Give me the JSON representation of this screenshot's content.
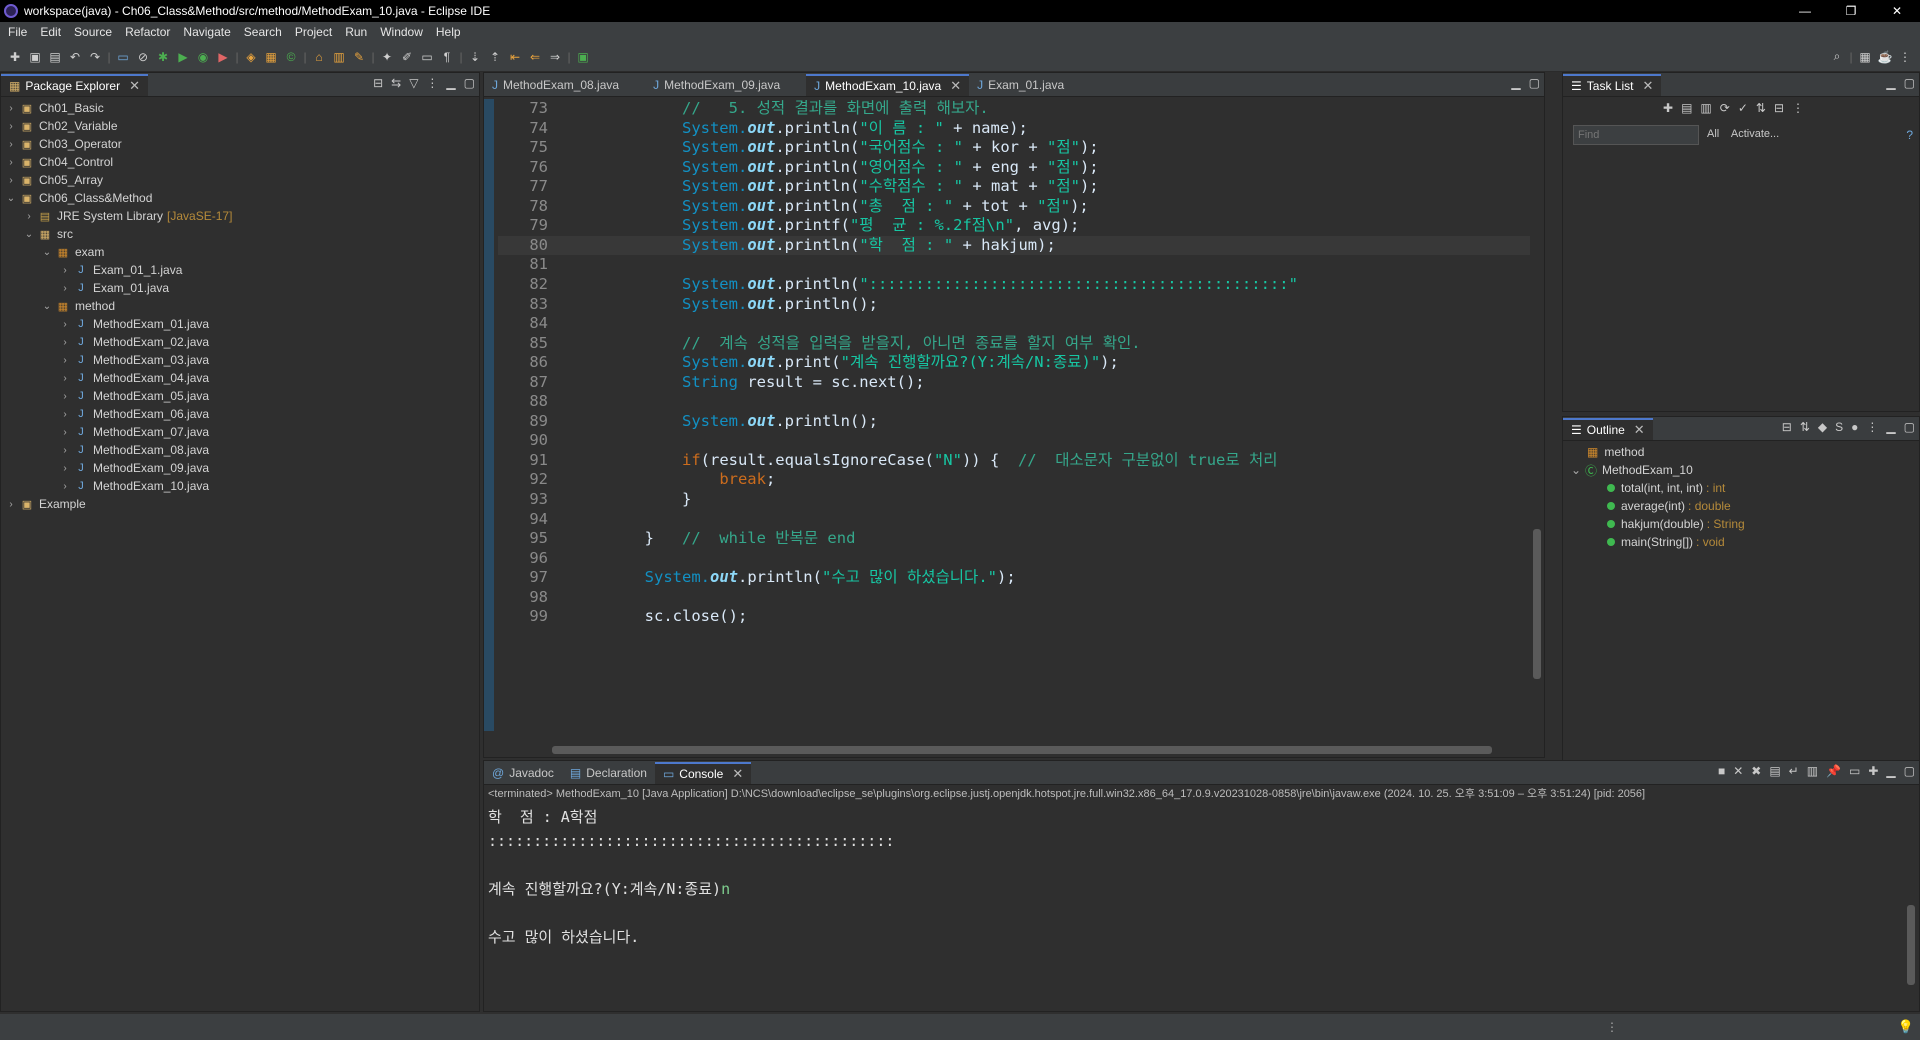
{
  "window": {
    "title": "workspace(java) - Ch06_Class&Method/src/method/MethodExam_10.java - Eclipse IDE",
    "controls": [
      "—",
      "❐",
      "✕"
    ]
  },
  "menu": [
    "File",
    "Edit",
    "Source",
    "Refactor",
    "Navigate",
    "Search",
    "Project",
    "Run",
    "Window",
    "Help"
  ],
  "package_explorer": {
    "title": "Package Explorer",
    "tree": [
      {
        "label": "Ch01_Basic",
        "type": "project",
        "depth": 0,
        "arrow": "›"
      },
      {
        "label": "Ch02_Variable",
        "type": "project",
        "depth": 0,
        "arrow": "›"
      },
      {
        "label": "Ch03_Operator",
        "type": "project",
        "depth": 0,
        "arrow": "›"
      },
      {
        "label": "Ch04_Control",
        "type": "project",
        "depth": 0,
        "arrow": "›"
      },
      {
        "label": "Ch05_Array",
        "type": "project",
        "depth": 0,
        "arrow": "›"
      },
      {
        "label": "Ch06_Class&Method",
        "type": "project",
        "depth": 0,
        "arrow": "⌄"
      },
      {
        "label": "JRE System Library",
        "deco": "[JavaSE-17]",
        "type": "lib",
        "depth": 1,
        "arrow": "›"
      },
      {
        "label": "src",
        "type": "src",
        "depth": 1,
        "arrow": "⌄"
      },
      {
        "label": "exam",
        "type": "pkg",
        "depth": 2,
        "arrow": "⌄"
      },
      {
        "label": "Exam_01_1.java",
        "type": "java",
        "depth": 3,
        "arrow": "›"
      },
      {
        "label": "Exam_01.java",
        "type": "java",
        "depth": 3,
        "arrow": "›"
      },
      {
        "label": "method",
        "type": "pkg",
        "depth": 2,
        "arrow": "⌄"
      },
      {
        "label": "MethodExam_01.java",
        "type": "java",
        "depth": 3,
        "arrow": "›"
      },
      {
        "label": "MethodExam_02.java",
        "type": "java",
        "depth": 3,
        "arrow": "›"
      },
      {
        "label": "MethodExam_03.java",
        "type": "java",
        "depth": 3,
        "arrow": "›"
      },
      {
        "label": "MethodExam_04.java",
        "type": "java",
        "depth": 3,
        "arrow": "›"
      },
      {
        "label": "MethodExam_05.java",
        "type": "java",
        "depth": 3,
        "arrow": "›"
      },
      {
        "label": "MethodExam_06.java",
        "type": "java",
        "depth": 3,
        "arrow": "›"
      },
      {
        "label": "MethodExam_07.java",
        "type": "java",
        "depth": 3,
        "arrow": "›"
      },
      {
        "label": "MethodExam_08.java",
        "type": "java",
        "depth": 3,
        "arrow": "›"
      },
      {
        "label": "MethodExam_09.java",
        "type": "java",
        "depth": 3,
        "arrow": "›"
      },
      {
        "label": "MethodExam_10.java",
        "type": "java",
        "depth": 3,
        "arrow": "›"
      },
      {
        "label": "Example",
        "type": "project",
        "depth": 0,
        "arrow": "›"
      }
    ]
  },
  "editor": {
    "tabs": [
      {
        "label": "MethodExam_08.java",
        "active": false
      },
      {
        "label": "MethodExam_09.java",
        "active": false
      },
      {
        "label": "MethodExam_10.java",
        "active": true
      },
      {
        "label": "Exam_01.java",
        "active": false
      }
    ],
    "current_line": 80,
    "lines": [
      {
        "n": "73",
        "indent": 12,
        "parts": [
          [
            "cmt",
            "//   5. 성적 결과를 화면에 출력 해보자."
          ]
        ]
      },
      {
        "n": "74",
        "indent": 12,
        "parts": [
          [
            "sysout",
            "System."
          ],
          [
            "out",
            "out"
          ],
          [
            "",
            ".println("
          ],
          [
            "str",
            "\"이 름 : \""
          ],
          [
            "",
            " + name);"
          ]
        ]
      },
      {
        "n": "75",
        "indent": 12,
        "parts": [
          [
            "sysout",
            "System."
          ],
          [
            "out",
            "out"
          ],
          [
            "",
            ".println("
          ],
          [
            "str",
            "\"국어점수 : \""
          ],
          [
            "",
            " + kor + "
          ],
          [
            "str",
            "\"점\""
          ],
          [
            "",
            ");"
          ]
        ]
      },
      {
        "n": "76",
        "indent": 12,
        "parts": [
          [
            "sysout",
            "System."
          ],
          [
            "out",
            "out"
          ],
          [
            "",
            ".println("
          ],
          [
            "str",
            "\"영어점수 : \""
          ],
          [
            "",
            " + eng + "
          ],
          [
            "str",
            "\"점\""
          ],
          [
            "",
            ");"
          ]
        ]
      },
      {
        "n": "77",
        "indent": 12,
        "parts": [
          [
            "sysout",
            "System."
          ],
          [
            "out",
            "out"
          ],
          [
            "",
            ".println("
          ],
          [
            "str",
            "\"수학점수 : \""
          ],
          [
            "",
            " + mat + "
          ],
          [
            "str",
            "\"점\""
          ],
          [
            "",
            ");"
          ]
        ]
      },
      {
        "n": "78",
        "indent": 12,
        "parts": [
          [
            "sysout",
            "System."
          ],
          [
            "out",
            "out"
          ],
          [
            "",
            ".println("
          ],
          [
            "str",
            "\"총  점 : \""
          ],
          [
            "",
            " + tot + "
          ],
          [
            "str",
            "\"점\""
          ],
          [
            "",
            ");"
          ]
        ]
      },
      {
        "n": "79",
        "indent": 12,
        "parts": [
          [
            "sysout",
            "System."
          ],
          [
            "out",
            "out"
          ],
          [
            "",
            ".printf("
          ],
          [
            "str",
            "\"평  균 : %.2f점\\n\""
          ],
          [
            "",
            ", avg);"
          ]
        ]
      },
      {
        "n": "80",
        "indent": 12,
        "parts": [
          [
            "sysout",
            "System."
          ],
          [
            "out",
            "out"
          ],
          [
            "",
            ".println("
          ],
          [
            "str",
            "\"학  점 : \""
          ],
          [
            "",
            " + hakjum);"
          ]
        ]
      },
      {
        "n": "81",
        "indent": 0,
        "parts": []
      },
      {
        "n": "82",
        "indent": 12,
        "parts": [
          [
            "sysout",
            "System."
          ],
          [
            "out",
            "out"
          ],
          [
            "",
            ".println("
          ],
          [
            "str",
            "\":::::::::::::::::::::::::::::::::::::::::::::\""
          ]
        ]
      },
      {
        "n": "83",
        "indent": 12,
        "parts": [
          [
            "sysout",
            "System."
          ],
          [
            "out",
            "out"
          ],
          [
            "",
            ".println();"
          ]
        ]
      },
      {
        "n": "84",
        "indent": 0,
        "parts": []
      },
      {
        "n": "85",
        "indent": 12,
        "parts": [
          [
            "cmt",
            "//  계속 성적을 입력을 받을지, 아니면 종료를 할지 여부 확인."
          ]
        ]
      },
      {
        "n": "86",
        "indent": 12,
        "parts": [
          [
            "sysout",
            "System."
          ],
          [
            "out",
            "out"
          ],
          [
            "",
            ".print("
          ],
          [
            "str",
            "\"계속 진행할까요?(Y:계속/N:종료)\""
          ],
          [
            "",
            ");"
          ]
        ]
      },
      {
        "n": "87",
        "indent": 12,
        "parts": [
          [
            "type",
            "String"
          ],
          [
            "",
            " result = sc.next();"
          ]
        ]
      },
      {
        "n": "88",
        "indent": 0,
        "parts": []
      },
      {
        "n": "89",
        "indent": 12,
        "parts": [
          [
            "sysout",
            "System."
          ],
          [
            "out",
            "out"
          ],
          [
            "",
            ".println();"
          ]
        ]
      },
      {
        "n": "90",
        "indent": 0,
        "parts": []
      },
      {
        "n": "91",
        "indent": 12,
        "parts": [
          [
            "kw",
            "if"
          ],
          [
            "",
            "(result.equalsIgnoreCase("
          ],
          [
            "str",
            "\"N\""
          ],
          [
            "",
            ")) {  "
          ],
          [
            "cmt",
            "//  대소문자 구분없이 true로 처리"
          ]
        ]
      },
      {
        "n": "92",
        "indent": 16,
        "parts": [
          [
            "kw",
            "break"
          ],
          [
            "",
            ";"
          ]
        ]
      },
      {
        "n": "93",
        "indent": 12,
        "parts": [
          [
            "",
            "}"
          ]
        ]
      },
      {
        "n": "94",
        "indent": 0,
        "parts": []
      },
      {
        "n": "95",
        "indent": 8,
        "parts": [
          [
            "",
            "}   "
          ],
          [
            "cmt",
            "//  while 반복문 end"
          ]
        ]
      },
      {
        "n": "96",
        "indent": 0,
        "parts": []
      },
      {
        "n": "97",
        "indent": 8,
        "parts": [
          [
            "sysout",
            "System."
          ],
          [
            "out",
            "out"
          ],
          [
            "",
            ".println("
          ],
          [
            "str",
            "\"수고 많이 하셨습니다.\""
          ],
          [
            "",
            ");"
          ]
        ]
      },
      {
        "n": "98",
        "indent": 0,
        "parts": []
      },
      {
        "n": "99",
        "indent": 8,
        "parts": [
          [
            "",
            "sc.close();"
          ]
        ]
      }
    ]
  },
  "task_list": {
    "title": "Task List",
    "find_placeholder": "Find",
    "filter_all": "All",
    "filter_activate": "Activate..."
  },
  "outline": {
    "title": "Outline",
    "package": "method",
    "class": "MethodExam_10",
    "members": [
      {
        "name": "total(int, int, int)",
        "ret": ": int"
      },
      {
        "name": "average(int)",
        "ret": ": double"
      },
      {
        "name": "hakjum(double)",
        "ret": ": String"
      },
      {
        "name": "main(String[])",
        "ret": ": void"
      }
    ]
  },
  "console": {
    "tabs": [
      {
        "label": "Javadoc",
        "active": false
      },
      {
        "label": "Declaration",
        "active": false
      },
      {
        "label": "Console",
        "active": true
      }
    ],
    "path": "<terminated> MethodExam_10 [Java Application] D:\\NCS\\download\\eclipse_se\\plugins\\org.eclipse.justj.openjdk.hotspot.jre.full.win32.x86_64_17.0.9.v20231028-0858\\jre\\bin\\javaw.exe  (2024. 10. 25. 오후 3:51:09 – 오후 3:51:24) [pid: 2056]",
    "lines": [
      {
        "text": "학  점 : A학점",
        "input": ""
      },
      {
        "text": ":::::::::::::::::::::::::::::::::::::::::::::",
        "input": ""
      },
      {
        "text": "",
        "input": ""
      },
      {
        "text": "계속 진행할까요?(Y:계속/N:종료)",
        "input": "n"
      },
      {
        "text": "",
        "input": ""
      },
      {
        "text": "수고 많이 하셨습니다.",
        "input": ""
      }
    ]
  },
  "colors": {
    "editor_bg": "#2f2f2f",
    "accent": "#4d78cc",
    "string": "#17c6a3",
    "comment": "#35a78b",
    "keyword": "#cc6c1d"
  }
}
